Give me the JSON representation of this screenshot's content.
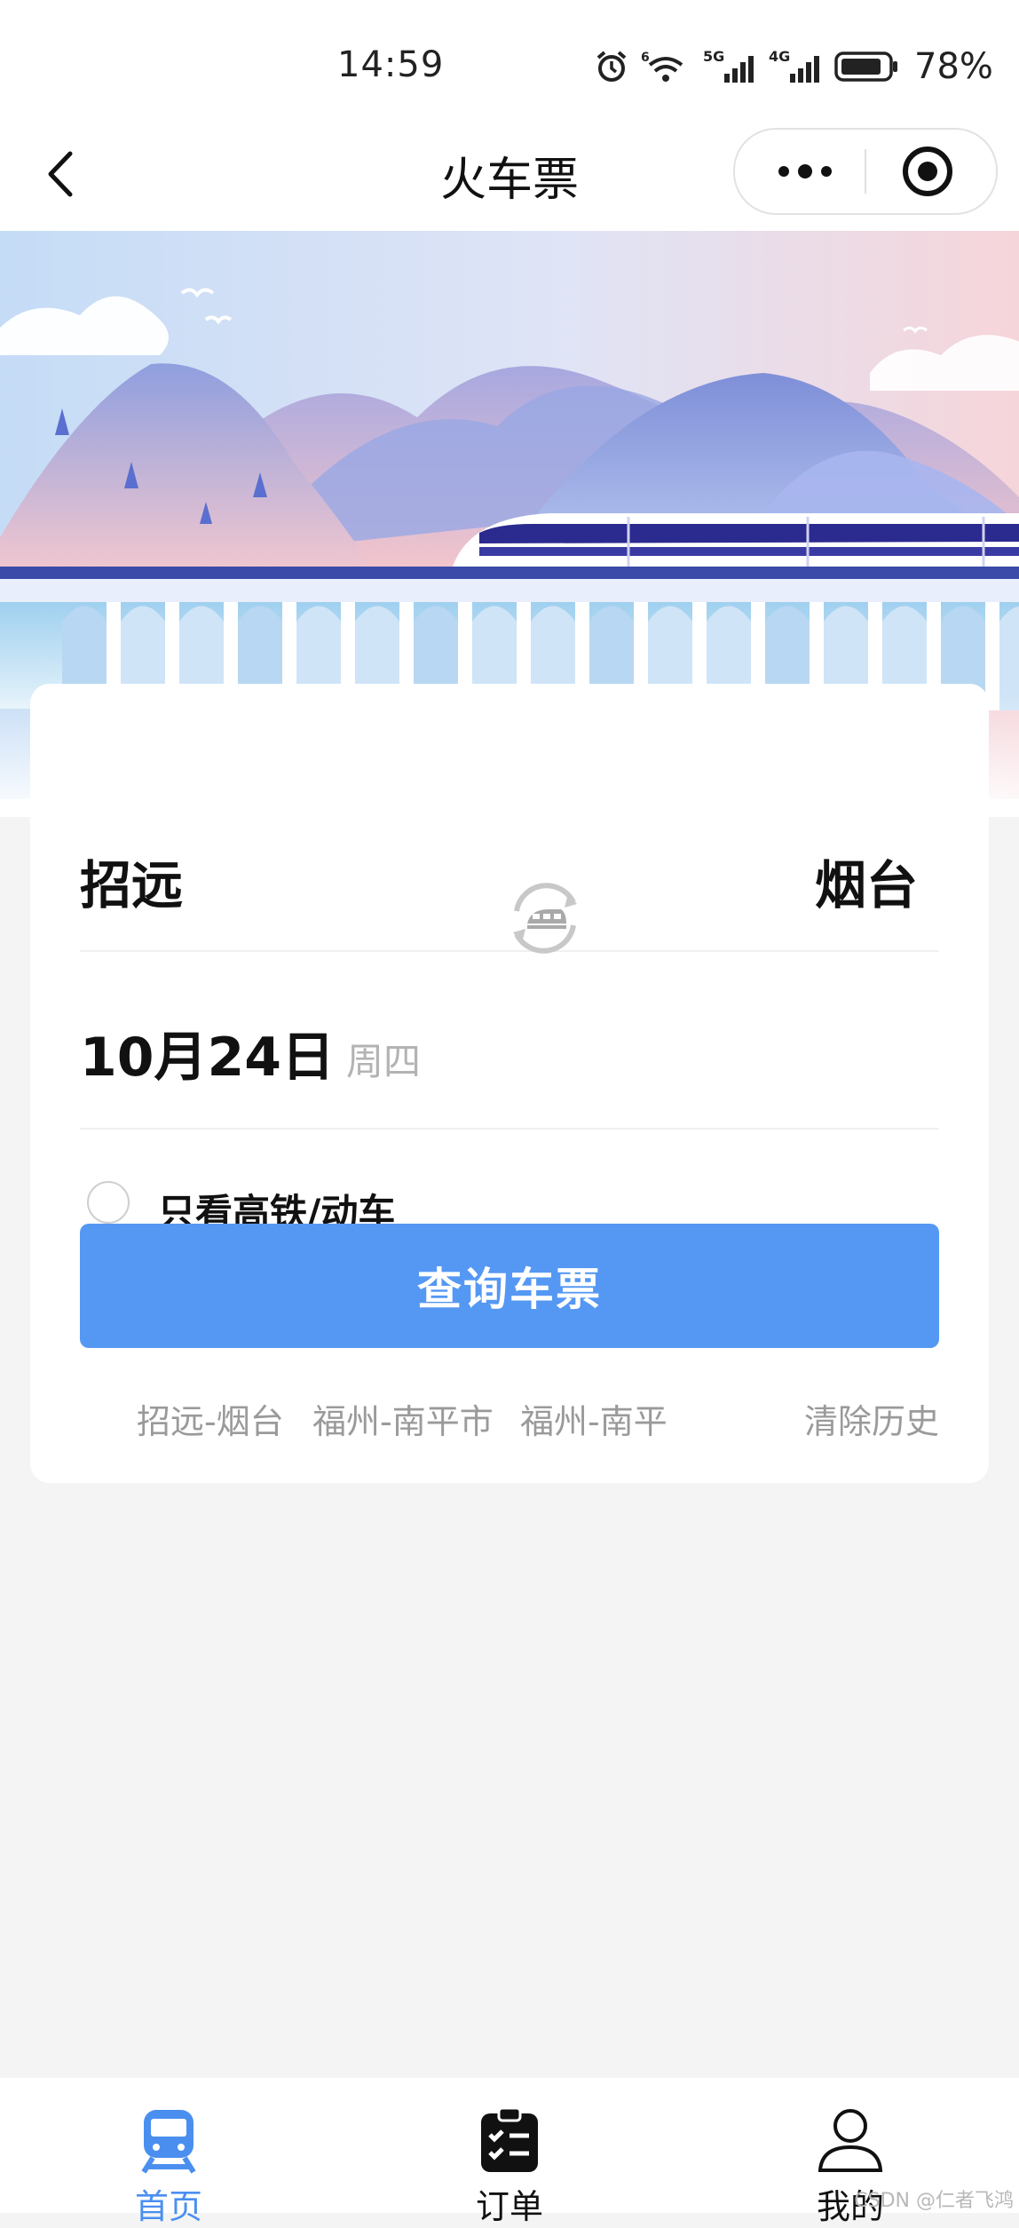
{
  "status_bar": {
    "time": "14:59",
    "battery_pct": "78%",
    "icons": [
      "alarm-icon",
      "wifi-icon",
      "signal-5g-icon",
      "signal-4g-icon",
      "battery-icon"
    ],
    "network_labels": {
      "wifi": "6",
      "sim1": "5G",
      "sim2": "4G"
    }
  },
  "nav": {
    "title": "火车票",
    "back_icon": "chevron-left-icon",
    "more_icon": "more-dots-icon",
    "close_icon": "target-circle-icon"
  },
  "search_card": {
    "from_station": "招远",
    "to_station": "烟台",
    "swap_icon": "train-swap-icon",
    "date": "10月24日",
    "weekday": "周四",
    "filter_label": "只看高铁/动车",
    "filter_checked": false,
    "search_button": "查询车票",
    "history": [
      "招远-烟台",
      "福州-南平市",
      "福州-南平"
    ],
    "clear_history": "清除历史"
  },
  "tabs": [
    {
      "label": "首页",
      "icon": "train-icon",
      "active": true
    },
    {
      "label": "订单",
      "icon": "clipboard-checklist-icon",
      "active": false
    },
    {
      "label": "我的",
      "icon": "user-icon",
      "active": false
    }
  ],
  "colors": {
    "accent": "#5598f3",
    "active_tab": "#4a8ff0",
    "muted_text": "#9a9a9a",
    "background": "#f4f4f4"
  },
  "watermark": "CSDN @仁者飞鸿"
}
